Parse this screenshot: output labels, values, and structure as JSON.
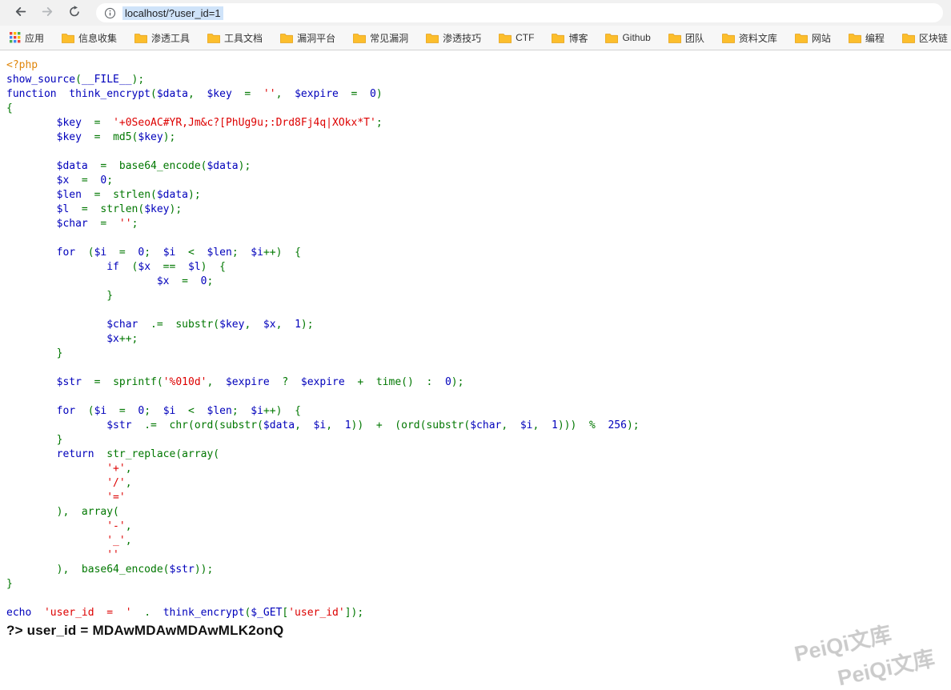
{
  "browser": {
    "url": "localhost/?user_id=1"
  },
  "icons": {
    "back": "arrow-left",
    "forward": "arrow-right",
    "reload": "circular-arrow",
    "site_info": "info-circle",
    "bookmark": "folder",
    "apps": "apps-grid"
  },
  "bookmarks_bar": {
    "items": [
      {
        "icon": "apps",
        "label": "应用"
      },
      {
        "icon": "folder",
        "label": "信息收集"
      },
      {
        "icon": "folder",
        "label": "渗透工具"
      },
      {
        "icon": "folder",
        "label": "工具文档"
      },
      {
        "icon": "folder",
        "label": "漏洞平台"
      },
      {
        "icon": "folder",
        "label": "常见漏洞"
      },
      {
        "icon": "folder",
        "label": "渗透技巧"
      },
      {
        "icon": "folder",
        "label": "CTF"
      },
      {
        "icon": "folder",
        "label": "博客"
      },
      {
        "icon": "folder",
        "label": "Github"
      },
      {
        "icon": "folder",
        "label": "团队"
      },
      {
        "icon": "folder",
        "label": "资料文库"
      },
      {
        "icon": "folder",
        "label": "网站"
      },
      {
        "icon": "folder",
        "label": "编程"
      },
      {
        "icon": "folder",
        "label": "区块链"
      }
    ]
  },
  "code": {
    "language": "php",
    "syntax_colors": {
      "tag": "#e0860b",
      "def": "#0000bb",
      "kw": "#007700",
      "str": "#dd0000"
    },
    "lines": [
      [
        [
          "tag",
          "<?php"
        ]
      ],
      [
        [
          "def",
          "show_source"
        ],
        [
          "kw",
          "("
        ],
        [
          "def",
          "__FILE__"
        ],
        [
          "kw",
          ");"
        ]
      ],
      [
        [
          "def",
          "function  think_encrypt"
        ],
        [
          "kw",
          "("
        ],
        [
          "def",
          "$data"
        ],
        [
          "kw",
          ",  "
        ],
        [
          "def",
          "$key"
        ],
        [
          "kw",
          "  =  "
        ],
        [
          "str",
          "''"
        ],
        [
          "kw",
          ",  "
        ],
        [
          "def",
          "$expire"
        ],
        [
          "kw",
          "  =  "
        ],
        [
          "def",
          "0"
        ],
        [
          "kw",
          ")"
        ]
      ],
      [
        [
          "kw",
          "{"
        ]
      ],
      [
        [
          "kw",
          "        "
        ],
        [
          "def",
          "$key"
        ],
        [
          "kw",
          "  =  "
        ],
        [
          "str",
          "'+0SeoAC#YR,Jm&c?[PhUg9u;:Drd8Fj4q|XOkx*T'"
        ],
        [
          "kw",
          ";"
        ]
      ],
      [
        [
          "kw",
          "        "
        ],
        [
          "def",
          "$key"
        ],
        [
          "kw",
          "  =  md5("
        ],
        [
          "def",
          "$key"
        ],
        [
          "kw",
          ");"
        ]
      ],
      [],
      [
        [
          "kw",
          "        "
        ],
        [
          "def",
          "$data"
        ],
        [
          "kw",
          "  =  base64_encode("
        ],
        [
          "def",
          "$data"
        ],
        [
          "kw",
          ");"
        ]
      ],
      [
        [
          "kw",
          "        "
        ],
        [
          "def",
          "$x"
        ],
        [
          "kw",
          "  =  "
        ],
        [
          "def",
          "0"
        ],
        [
          "kw",
          ";"
        ]
      ],
      [
        [
          "kw",
          "        "
        ],
        [
          "def",
          "$len"
        ],
        [
          "kw",
          "  =  strlen("
        ],
        [
          "def",
          "$data"
        ],
        [
          "kw",
          ");"
        ]
      ],
      [
        [
          "kw",
          "        "
        ],
        [
          "def",
          "$l"
        ],
        [
          "kw",
          "  =  strlen("
        ],
        [
          "def",
          "$key"
        ],
        [
          "kw",
          ");"
        ]
      ],
      [
        [
          "kw",
          "        "
        ],
        [
          "def",
          "$char"
        ],
        [
          "kw",
          "  =  "
        ],
        [
          "str",
          "''"
        ],
        [
          "kw",
          ";"
        ]
      ],
      [],
      [
        [
          "kw",
          "        "
        ],
        [
          "def",
          "for"
        ],
        [
          "kw",
          "  ("
        ],
        [
          "def",
          "$i"
        ],
        [
          "kw",
          "  =  "
        ],
        [
          "def",
          "0"
        ],
        [
          "kw",
          ";  "
        ],
        [
          "def",
          "$i"
        ],
        [
          "kw",
          "  <  "
        ],
        [
          "def",
          "$len"
        ],
        [
          "kw",
          ";  "
        ],
        [
          "def",
          "$i"
        ],
        [
          "kw",
          "++)  {"
        ]
      ],
      [
        [
          "kw",
          "                "
        ],
        [
          "def",
          "if"
        ],
        [
          "kw",
          "  ("
        ],
        [
          "def",
          "$x"
        ],
        [
          "kw",
          "  ==  "
        ],
        [
          "def",
          "$l"
        ],
        [
          "kw",
          ")  {"
        ]
      ],
      [
        [
          "kw",
          "                        "
        ],
        [
          "def",
          "$x"
        ],
        [
          "kw",
          "  =  "
        ],
        [
          "def",
          "0"
        ],
        [
          "kw",
          ";"
        ]
      ],
      [
        [
          "kw",
          "                }"
        ]
      ],
      [],
      [
        [
          "kw",
          "                "
        ],
        [
          "def",
          "$char"
        ],
        [
          "kw",
          "  .=  substr("
        ],
        [
          "def",
          "$key"
        ],
        [
          "kw",
          ",  "
        ],
        [
          "def",
          "$x"
        ],
        [
          "kw",
          ",  "
        ],
        [
          "def",
          "1"
        ],
        [
          "kw",
          ");"
        ]
      ],
      [
        [
          "kw",
          "                "
        ],
        [
          "def",
          "$x"
        ],
        [
          "kw",
          "++;"
        ]
      ],
      [
        [
          "kw",
          "        }"
        ]
      ],
      [],
      [
        [
          "kw",
          "        "
        ],
        [
          "def",
          "$str"
        ],
        [
          "kw",
          "  =  sprintf("
        ],
        [
          "str",
          "'%010d'"
        ],
        [
          "kw",
          ",  "
        ],
        [
          "def",
          "$expire"
        ],
        [
          "kw",
          "  ?  "
        ],
        [
          "def",
          "$expire"
        ],
        [
          "kw",
          "  +  time()  :  "
        ],
        [
          "def",
          "0"
        ],
        [
          "kw",
          ");"
        ]
      ],
      [],
      [
        [
          "kw",
          "        "
        ],
        [
          "def",
          "for"
        ],
        [
          "kw",
          "  ("
        ],
        [
          "def",
          "$i"
        ],
        [
          "kw",
          "  =  "
        ],
        [
          "def",
          "0"
        ],
        [
          "kw",
          ";  "
        ],
        [
          "def",
          "$i"
        ],
        [
          "kw",
          "  <  "
        ],
        [
          "def",
          "$len"
        ],
        [
          "kw",
          ";  "
        ],
        [
          "def",
          "$i"
        ],
        [
          "kw",
          "++)  {"
        ]
      ],
      [
        [
          "kw",
          "                "
        ],
        [
          "def",
          "$str"
        ],
        [
          "kw",
          "  .=  chr(ord(substr("
        ],
        [
          "def",
          "$data"
        ],
        [
          "kw",
          ",  "
        ],
        [
          "def",
          "$i"
        ],
        [
          "kw",
          ",  "
        ],
        [
          "def",
          "1"
        ],
        [
          "kw",
          "))  +  (ord(substr("
        ],
        [
          "def",
          "$char"
        ],
        [
          "kw",
          ",  "
        ],
        [
          "def",
          "$i"
        ],
        [
          "kw",
          ",  "
        ],
        [
          "def",
          "1"
        ],
        [
          "kw",
          ")))  %  "
        ],
        [
          "def",
          "256"
        ],
        [
          "kw",
          ");"
        ]
      ],
      [
        [
          "kw",
          "        }"
        ]
      ],
      [
        [
          "kw",
          "        "
        ],
        [
          "def",
          "return"
        ],
        [
          "kw",
          "  str_replace(array("
        ]
      ],
      [
        [
          "kw",
          "                "
        ],
        [
          "str",
          "'+'"
        ],
        [
          "kw",
          ","
        ]
      ],
      [
        [
          "kw",
          "                "
        ],
        [
          "str",
          "'/'"
        ],
        [
          "kw",
          ","
        ]
      ],
      [
        [
          "kw",
          "                "
        ],
        [
          "str",
          "'='"
        ]
      ],
      [
        [
          "kw",
          "        ),  array("
        ]
      ],
      [
        [
          "kw",
          "                "
        ],
        [
          "str",
          "'-'"
        ],
        [
          "kw",
          ","
        ]
      ],
      [
        [
          "kw",
          "                "
        ],
        [
          "str",
          "'_'"
        ],
        [
          "kw",
          ","
        ]
      ],
      [
        [
          "kw",
          "                "
        ],
        [
          "str",
          "''"
        ]
      ],
      [
        [
          "kw",
          "        ),  base64_encode("
        ],
        [
          "def",
          "$str"
        ],
        [
          "kw",
          "));"
        ]
      ],
      [
        [
          "kw",
          "}"
        ]
      ],
      [],
      [
        [
          "def",
          "echo"
        ],
        [
          "kw",
          "  "
        ],
        [
          "str",
          "'user_id  =  '"
        ],
        [
          "kw",
          "  .  "
        ],
        [
          "def",
          "think_encrypt"
        ],
        [
          "kw",
          "("
        ],
        [
          "def",
          "$_GET"
        ],
        [
          "kw",
          "["
        ],
        [
          "str",
          "'user_id'"
        ],
        [
          "kw",
          "]);"
        ]
      ]
    ]
  },
  "output_line": "?> user_id = MDAwMDAwMDAwMLK2onQ",
  "watermark": "PeiQi文库"
}
